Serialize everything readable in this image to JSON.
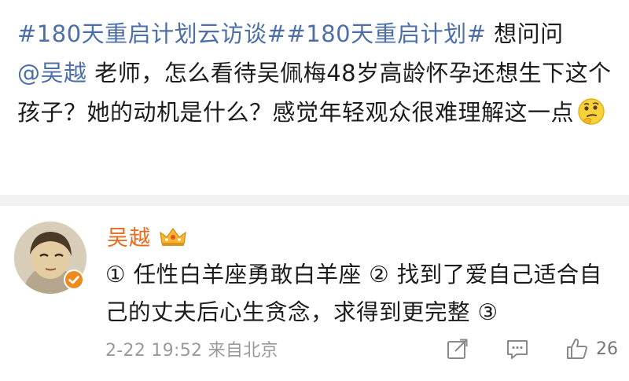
{
  "post": {
    "topic1": "#180天重启计划云访谈#",
    "topic2": "#180天重启计划#",
    "text_after_topics": " 想问问",
    "mention": "@吴越",
    "body": " 老师，怎么看待吴佩梅48岁高龄怀孕还想生下这个孩子？她的动机是什么？感觉年轻观众很难理解这一点",
    "emoji": "thinking-face-emoji"
  },
  "comment": {
    "author": "吴越",
    "author_badge": "crown-badge-icon",
    "verified_badge": "verified-icon",
    "text": "① 任性白羊座勇敢白羊座 ② 找到了爱自己适合自己的丈夫后心生贪念，求得到更完整 ③",
    "timestamp": "2-22 19:52",
    "source": "来自北京",
    "likes": "26"
  },
  "colors": {
    "link": "#4d6fa8",
    "author": "#e86a1c",
    "verified": "#f08a1c",
    "meta": "#9a9a9a"
  }
}
